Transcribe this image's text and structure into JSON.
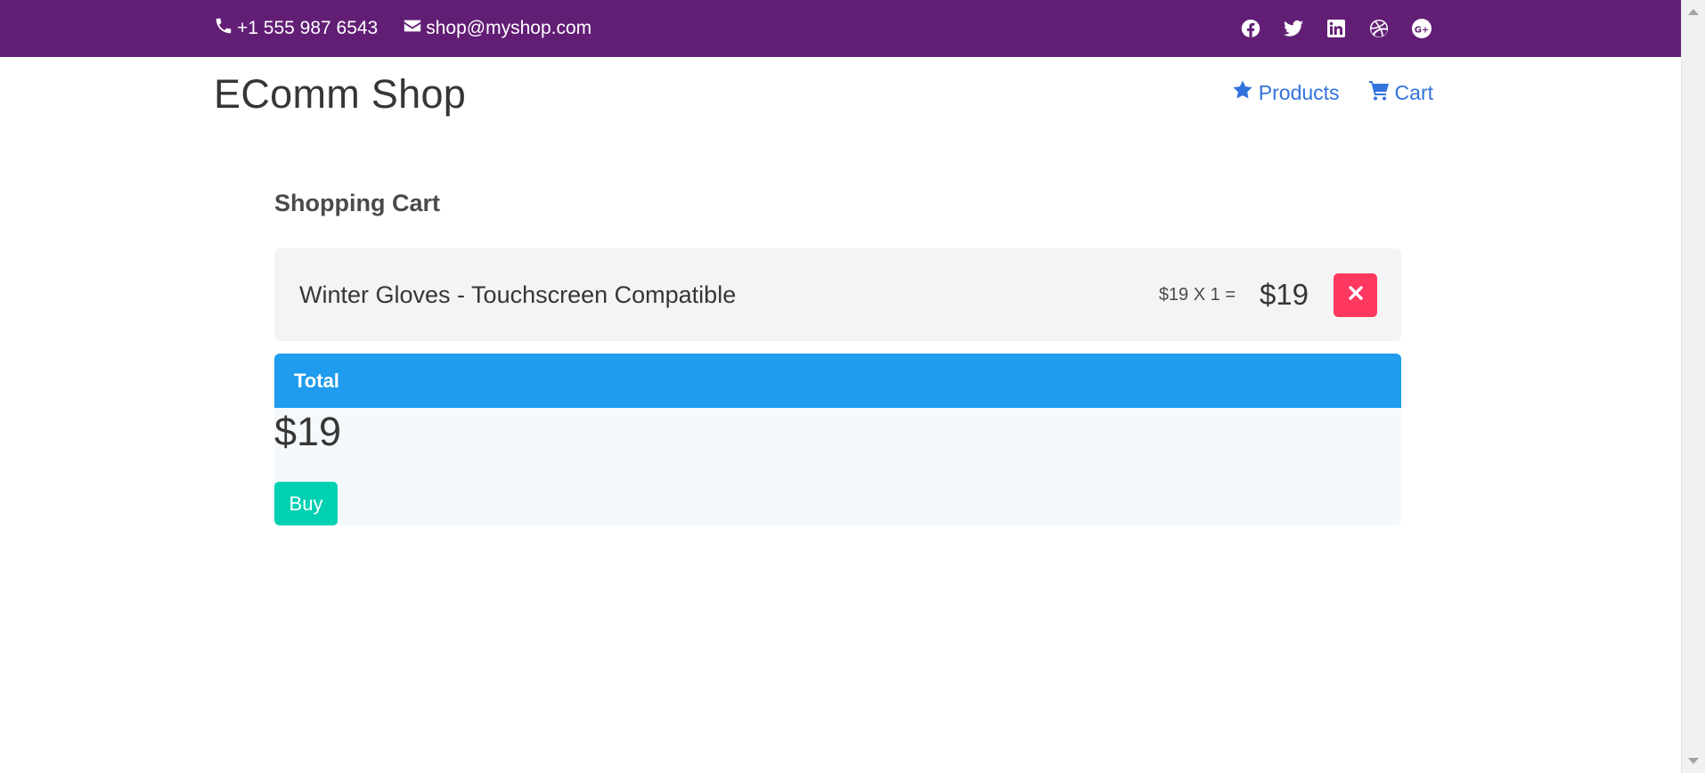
{
  "topbar": {
    "phone": "+1 555 987 6543",
    "email": "shop@myshop.com",
    "social_icons": [
      "facebook-icon",
      "twitter-icon",
      "linkedin-icon",
      "dribbble-icon",
      "google-plus-icon"
    ],
    "background": "#621e75"
  },
  "header": {
    "brand": "EComm Shop",
    "nav": [
      {
        "label": "Products",
        "icon": "star-icon"
      },
      {
        "label": "Cart",
        "icon": "cart-icon"
      }
    ],
    "link_color": "#3273dc"
  },
  "cart": {
    "title": "Shopping Cart",
    "items": [
      {
        "name": "Winter Gloves - Touchscreen Compatible",
        "calc": "$19 X 1 =",
        "line_total": "$19",
        "remove_icon": "close-icon"
      }
    ],
    "total_label": "Total",
    "total_amount": "$19",
    "buy_label": "Buy"
  },
  "colors": {
    "total_header": "#209cee",
    "remove_button": "#ff3860",
    "buy_button": "#00d1b2"
  }
}
